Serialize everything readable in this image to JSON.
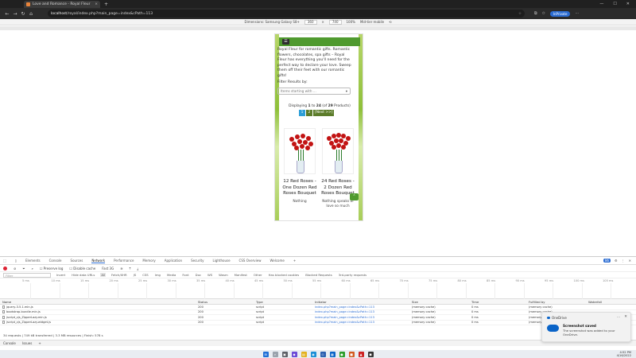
{
  "browser": {
    "tab_title": "Love and Romance - Royal Fleur",
    "tab_close": "×",
    "new_tab": "+",
    "url_host": "localhost",
    "url_path": "/royal/index.php?main_page=index&cPath=113",
    "profile": "InPrivate",
    "back": "←",
    "forward": "→",
    "refresh": "↻",
    "home": "⌂",
    "minimize": "—",
    "maximize": "☐",
    "close": "✕"
  },
  "device_toolbar": {
    "dimensions": "Dimensions: Samsung Galaxy S8+",
    "width": "360",
    "times": "×",
    "height": "740",
    "zoom": "100%",
    "throttle": "Mid-tier mobile"
  },
  "site": {
    "menu_icon": "☰",
    "intro": "Royal Fleur for romantic gifts. Romantic flowers, chocolates, spa gifts – Royal Fleur has everything you'll need for the perfect way to declare your love. Sweep them off their feet with our romantic gifts!",
    "filter_label": "Filter Results by:",
    "filter_placeholder": "Items starting with ...",
    "filter_arrow": "▾",
    "display_prefix": "Displaying ",
    "display_from": "1",
    "display_mid": " to ",
    "display_to": "24",
    "display_of": " (of ",
    "display_total": "29",
    "display_suffix": " Products)",
    "pager": {
      "current": "1",
      "page2": "2",
      "next": "[Next >>]"
    },
    "products": [
      {
        "title": "12 Red Roses - One Dozen Red Roses Bouquet",
        "desc": "Nothing"
      },
      {
        "title": "24 Red Roses - 2 Dozen Red Roses Bouquet",
        "desc": "Nothing speaks of love so much"
      }
    ],
    "scroll_top": "⌃"
  },
  "devtools": {
    "tabs": [
      "Elements",
      "Console",
      "Sources",
      "Network",
      "Performance",
      "Memory",
      "Application",
      "Security",
      "Lighthouse",
      "CSS Overview",
      "Welcome"
    ],
    "active_tab": "Network",
    "issues_count": "86",
    "toolbar": {
      "preserve_log": "Preserve log",
      "disable_cache": "Disable cache",
      "throttle": "Fast 3G"
    },
    "filter_placeholder": "Filter",
    "filter_options": [
      "Invert",
      "Hide data URLs",
      "All",
      "Fetch/XHR",
      "JS",
      "CSS",
      "Img",
      "Media",
      "Font",
      "Doc",
      "WS",
      "Wasm",
      "Manifest",
      "Other",
      "Has blocked cookies",
      "Blocked Requests",
      "3rd-party requests"
    ],
    "timeline_ticks": [
      "5 ms",
      "10 ms",
      "15 ms",
      "20 ms",
      "25 ms",
      "30 ms",
      "35 ms",
      "40 ms",
      "45 ms",
      "50 ms",
      "55 ms",
      "60 ms",
      "65 ms",
      "70 ms",
      "75 ms",
      "80 ms",
      "85 ms",
      "90 ms",
      "95 ms",
      "100 ms",
      "105 ms"
    ],
    "columns": [
      "Name",
      "Status",
      "Type",
      "Initiator",
      "Size",
      "Time",
      "Fulfilled by",
      "Waterfall"
    ],
    "rows": [
      {
        "name": "jquery-3.5.1.min.js",
        "status": "200",
        "type": "script",
        "initiator": "index.php?main_page=index&cPath=113",
        "size": "(memory cache)",
        "time": "0 ms",
        "fulfilled": "(memory cache)"
      },
      {
        "name": "bootstrap.bundle.min.js",
        "status": "200",
        "type": "script",
        "initiator": "index.php?main_page=index&cPath=113",
        "size": "(memory cache)",
        "time": "0 ms",
        "fulfilled": "(memory cache)"
      },
      {
        "name": "jscript_zjs_ZipperLazy.min.js",
        "status": "200",
        "type": "script",
        "initiator": "index.php?main_page=index&cPath=113",
        "size": "(memory cache)",
        "time": "0 ms",
        "fulfilled": "(memory cache)"
      },
      {
        "name": "jscript_zjs_ZipperLazy.widget.js",
        "status": "200",
        "type": "script",
        "initiator": "index.php?main_page=index&cPath=113",
        "size": "(memory cache)",
        "time": "0 ms",
        "fulfilled": "(memory cache)"
      }
    ],
    "summary": "34 requests | 749 kB transferred | 3.3 MB resources | Finish: 578 s",
    "console_tabs": [
      "Console",
      "Issues"
    ]
  },
  "toast": {
    "app": "OneDrive",
    "title": "Screenshot saved",
    "body": "The screenshot was added to your OneDrive.",
    "more": "…",
    "close": "✕"
  },
  "taskbar": {
    "time": "4:52 PM",
    "date": "4/16/2022"
  }
}
